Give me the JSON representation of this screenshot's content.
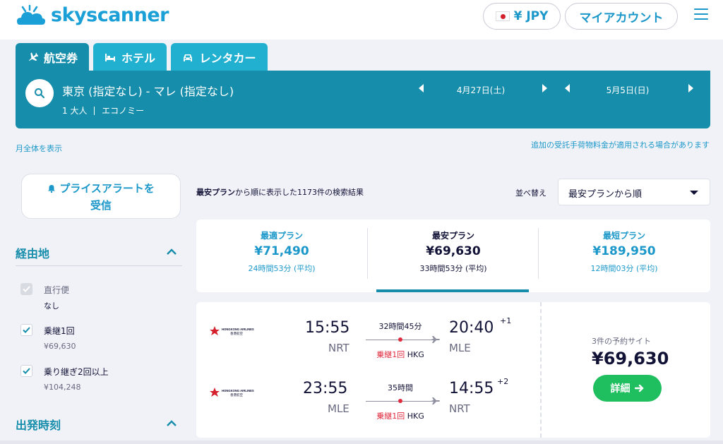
{
  "header": {
    "brand": "skyscanner",
    "currency": "¥ JPY",
    "account": "マイアカウント"
  },
  "tabs": [
    {
      "label": "航空券",
      "icon": "plane-icon",
      "active": true
    },
    {
      "label": "ホテル",
      "icon": "bed-icon",
      "active": false
    },
    {
      "label": "レンタカー",
      "icon": "car-icon",
      "active": false
    }
  ],
  "search": {
    "route": "東京 (指定なし) - マレ (指定なし)",
    "passengers": "1 大人",
    "cabin": "エコノミー",
    "depart_date": "4月27日(土)",
    "return_date": "5月5日(日)"
  },
  "links": {
    "month_view": "月全体を表示",
    "baggage_note": "追加の受託手荷物料金が適用される場合があります"
  },
  "sidebar": {
    "price_alert": [
      "プライスアラートを",
      "受信"
    ],
    "stops_title": "経由地",
    "options": [
      {
        "label": "直行便",
        "sub": "なし",
        "checked": true,
        "disabled": true
      },
      {
        "label": "乗継1回",
        "sub": "¥69,630",
        "checked": true,
        "disabled": false
      },
      {
        "label": "乗り継ぎ2回以上",
        "sub": "¥104,248",
        "checked": true,
        "disabled": false
      }
    ],
    "departure_title": "出発時刻"
  },
  "results": {
    "count_bold": "最安プラン",
    "count_rest": "から順に表示した1173件の検索結果",
    "sort_label": "並べ替え",
    "sort_value": "最安プランから順"
  },
  "summary": [
    {
      "label": "最適プラン",
      "price": "¥71,490",
      "duration": "24時間53分 (平均)",
      "active": false
    },
    {
      "label": "最安プラン",
      "price": "¥69,630",
      "duration": "33時間53分 (平均)",
      "active": true
    },
    {
      "label": "最短プラン",
      "price": "¥189,950",
      "duration": "12時間03分 (平均)",
      "active": false
    }
  ],
  "card": {
    "airline": "HONGKONG AIRLINES",
    "airline_local": "香港航空",
    "legs": [
      {
        "dep_time": "15:55",
        "dep_airport": "NRT",
        "duration": "32時間45分",
        "stops": "乗継1回",
        "via": "HKG",
        "arr_time": "20:40",
        "arr_plus": "+1",
        "arr_airport": "MLE"
      },
      {
        "dep_time": "23:55",
        "dep_airport": "MLE",
        "duration": "35時間",
        "stops": "乗継1回",
        "via": "HKG",
        "arr_time": "14:55",
        "arr_plus": "+2",
        "arr_airport": "NRT"
      }
    ],
    "sites": "3件の予約サイト",
    "price": "¥69,630",
    "detail": "詳細"
  },
  "colors": {
    "brand_dark": "#168daa",
    "brand_light": "#21b0d0",
    "accent_link": "#1b98c9",
    "stop_red": "#e02c3f",
    "cta_green": "#1fbf5f"
  }
}
